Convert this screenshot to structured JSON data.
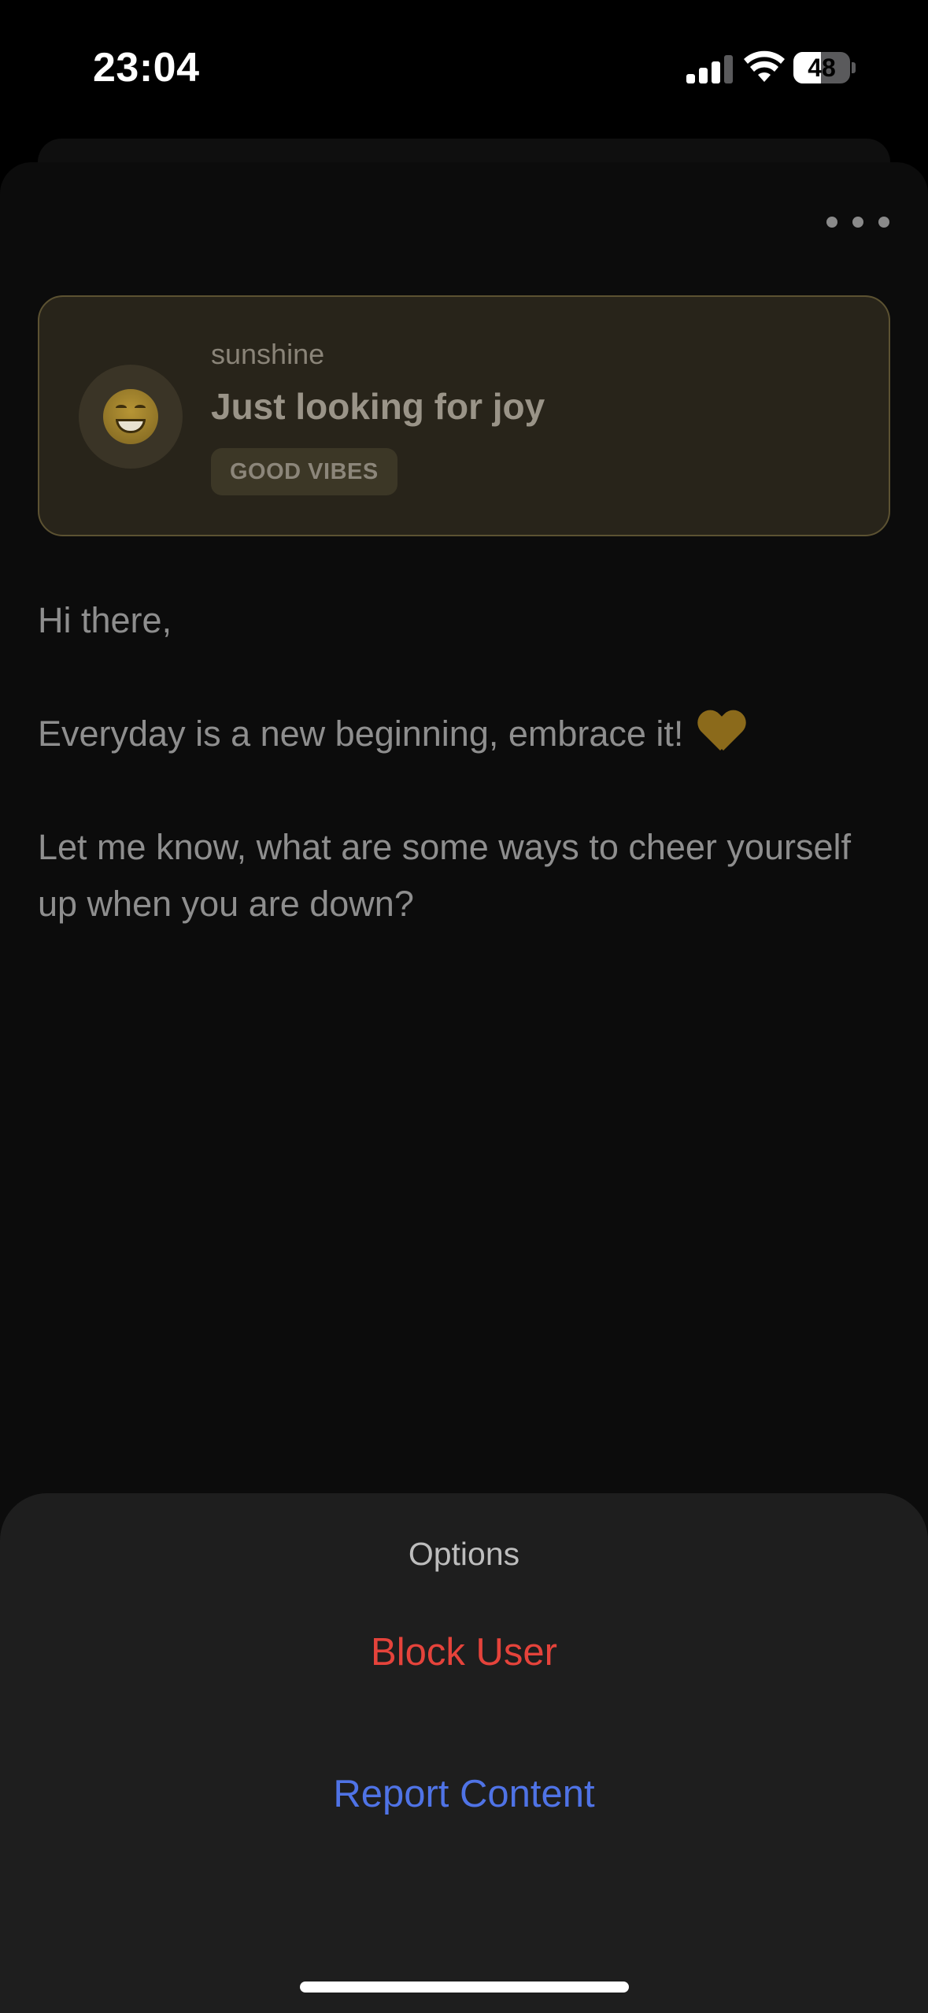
{
  "status_bar": {
    "time": "23:04",
    "battery": "48",
    "battery_level": 0.48,
    "icons": [
      "cellular-signal-icon",
      "wifi-icon",
      "battery-icon"
    ]
  },
  "post": {
    "more_icon": "ellipsis-icon",
    "card": {
      "avatar_emoji": "grinning-face-icon",
      "username": "sunshine",
      "status": "Just looking for joy",
      "tag": "GOOD VIBES"
    },
    "message": {
      "line1": "Hi there,",
      "line2": "Everyday is a new beginning, embrace it!",
      "line2_emoji": "yellow-heart-icon",
      "line3": "Let me know, what are some ways to cheer yourself up when you are down?"
    }
  },
  "options_sheet": {
    "title": "Options",
    "block_label": "Block User",
    "report_label": "Report Content"
  },
  "colors": {
    "destructive": "#e5433b",
    "accent": "#4f73e6",
    "card_border": "#5c5232"
  }
}
